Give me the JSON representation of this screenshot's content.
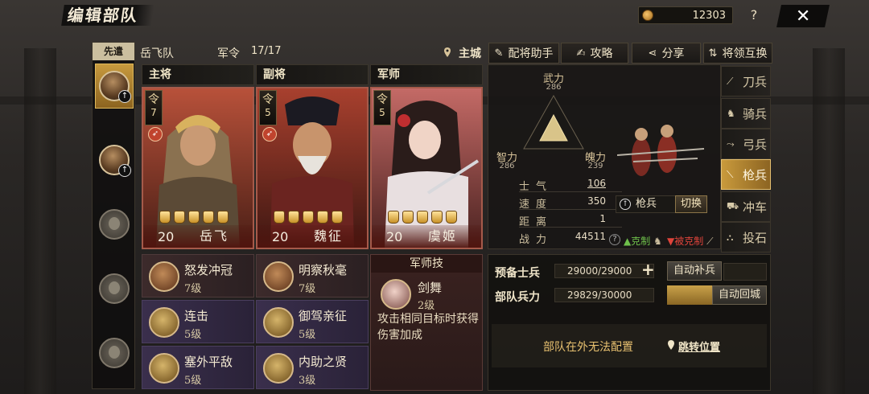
{
  "header": {
    "title": "编辑部队",
    "currency": "12303",
    "help": "?",
    "close": "✕"
  },
  "slots": {
    "tab": "先遣",
    "badge_symbol": "↑"
  },
  "team": {
    "name": "岳飞队",
    "command_label": "军令",
    "command_value": "17/17",
    "city": "主城"
  },
  "roles": [
    "主将",
    "副将",
    "军师"
  ],
  "generals": [
    {
      "ling": "令",
      "cost": "7",
      "level": "20",
      "name": "岳飞"
    },
    {
      "ling": "令",
      "cost": "5",
      "level": "20",
      "name": "魏征"
    },
    {
      "ling": "令",
      "cost": "5",
      "level": "20",
      "name": "虞姬"
    }
  ],
  "skills": [
    {
      "name": "怒发冲冠",
      "level": "7级"
    },
    {
      "name": "明察秋毫",
      "level": "7级"
    },
    {
      "name": "连击",
      "level": "5级"
    },
    {
      "name": "御驾亲征",
      "level": "5级"
    },
    {
      "name": "塞外平敌",
      "level": "5级"
    },
    {
      "name": "内助之贤",
      "level": "3级"
    }
  ],
  "strategist": {
    "header": "军师技",
    "name": "剑舞",
    "level": "2级",
    "desc": "攻击相同目标时获得伤害加成"
  },
  "toolbar": {
    "helper": "配将助手",
    "guide": "攻略",
    "share": "分享",
    "swap": "将领互换"
  },
  "stats": {
    "wu": {
      "label": "武力",
      "value": "286"
    },
    "zhi": {
      "label": "智力",
      "value": "286"
    },
    "mei": {
      "label": "魄力",
      "value": "239"
    },
    "rows": [
      {
        "label": "士气",
        "value": "106"
      },
      {
        "label": "速度",
        "value": "350"
      },
      {
        "label": "距离",
        "value": "1"
      },
      {
        "label": "战力",
        "value": "44511"
      }
    ],
    "troop": "枪兵",
    "switch": "切换",
    "counter": "克制",
    "countered": "被克制"
  },
  "troop_types": [
    "刀兵",
    "骑兵",
    "弓兵",
    "枪兵",
    "冲车",
    "投石"
  ],
  "supply": {
    "reserve_label": "预备士兵",
    "reserve_value": "29000/29000",
    "auto_fill": "自动补兵",
    "strength_label": "部队兵力",
    "strength_value": "29829/30000",
    "auto_return": "自动回城",
    "notice": "部队在外无法配置",
    "jump": "跳转位置"
  }
}
